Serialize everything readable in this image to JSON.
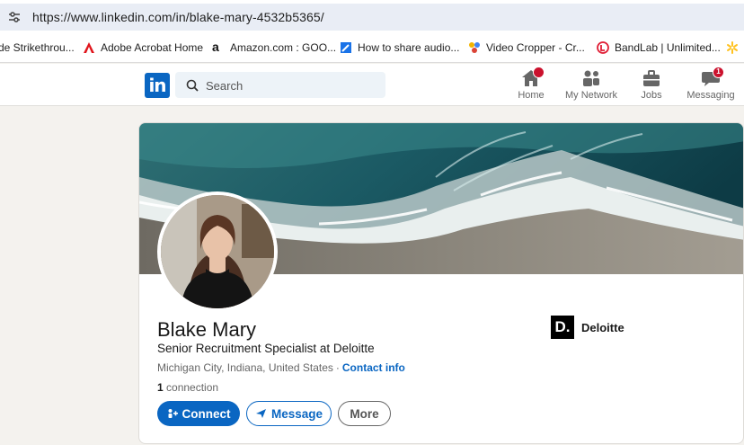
{
  "browser": {
    "url": "https://www.linkedin.com/in/blake-mary-4532b5365/",
    "bookmarks": [
      {
        "label": "de Strikethrou...",
        "icon": "text-icon"
      },
      {
        "label": "Adobe Acrobat Home",
        "icon": "adobe-icon"
      },
      {
        "label": "Amazon.com : GOO...",
        "icon": "amazon-icon"
      },
      {
        "label": "How to share audio...",
        "icon": "edit-icon"
      },
      {
        "label": "Video Cropper - Cr...",
        "icon": "dots-icon"
      },
      {
        "label": "BandLab | Unlimited...",
        "icon": "bandlab-icon"
      }
    ]
  },
  "header": {
    "logo": "in",
    "search_placeholder": "Search",
    "nav": [
      {
        "label": "Home",
        "icon": "home-icon",
        "badge": ""
      },
      {
        "label": "My Network",
        "icon": "network-icon",
        "badge": ""
      },
      {
        "label": "Jobs",
        "icon": "briefcase-icon",
        "badge": ""
      },
      {
        "label": "Messaging",
        "icon": "messaging-icon",
        "badge": "1"
      }
    ]
  },
  "profile": {
    "name": "Blake Mary",
    "headline": "Senior Recruitment Specialist at Deloitte",
    "location": "Michigan City, Indiana, United States",
    "separator": "·",
    "contact_info": "Contact info",
    "connections_count": "1",
    "connections_label": "connection",
    "buttons": {
      "connect": "Connect",
      "message": "Message",
      "more": "More"
    },
    "company": {
      "logo_text": "D.",
      "name": "Deloitte"
    }
  },
  "colors": {
    "brand": "#0a66c2",
    "badge": "#cb112d",
    "page_bg": "#f4f2ee"
  }
}
